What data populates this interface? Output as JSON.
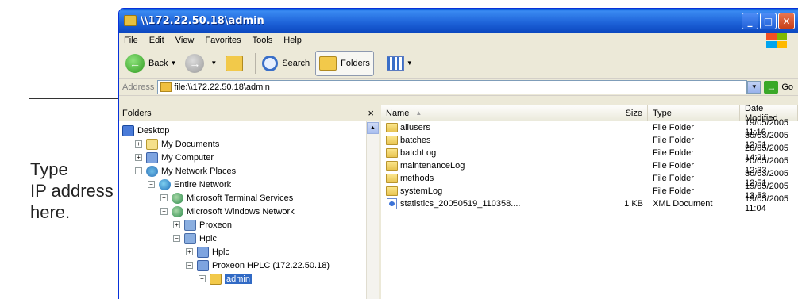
{
  "annotation": {
    "lines": [
      "Type",
      "IP address",
      "here."
    ]
  },
  "window": {
    "title": "\\\\172.22.50.18\\admin",
    "controls": [
      "_",
      "□",
      "✕"
    ]
  },
  "menu": [
    "File",
    "Edit",
    "View",
    "Favorites",
    "Tools",
    "Help"
  ],
  "toolbar": {
    "back_label": "Back",
    "search_label": "Search",
    "folders_label": "Folders"
  },
  "address": {
    "label": "Address",
    "value": "file:\\\\172.22.50.18\\admin",
    "go_label": "Go"
  },
  "folders_pane": {
    "header": "Folders",
    "close": "×",
    "tree": [
      {
        "label": "Desktop",
        "depth": 0,
        "icon": "desktop",
        "exp": ""
      },
      {
        "label": "My Documents",
        "depth": 1,
        "icon": "docs",
        "exp": "+"
      },
      {
        "label": "My Computer",
        "depth": 1,
        "icon": "comp",
        "exp": "+"
      },
      {
        "label": "My Network Places",
        "depth": 1,
        "icon": "net",
        "exp": "−"
      },
      {
        "label": "Entire Network",
        "depth": 2,
        "icon": "globe",
        "exp": "−"
      },
      {
        "label": "Microsoft Terminal Services",
        "depth": 3,
        "icon": "ms",
        "exp": "+"
      },
      {
        "label": "Microsoft Windows Network",
        "depth": 3,
        "icon": "ms",
        "exp": "−"
      },
      {
        "label": "Proxeon",
        "depth": 4,
        "icon": "group",
        "exp": "+"
      },
      {
        "label": "Hplc",
        "depth": 4,
        "icon": "group",
        "exp": "−"
      },
      {
        "label": "Hplc",
        "depth": 5,
        "icon": "comp",
        "exp": "+"
      },
      {
        "label": "Proxeon HPLC (172.22.50.18)",
        "depth": 5,
        "icon": "comp",
        "exp": "−"
      },
      {
        "label": "admin",
        "depth": 6,
        "icon": "share",
        "exp": "+"
      }
    ]
  },
  "file_list": {
    "columns": [
      "Name",
      "Size",
      "Type",
      "Date Modified"
    ],
    "rows": [
      {
        "name": "allusers",
        "size": "",
        "type": "File Folder",
        "date": "19/05/2005 11:16",
        "icon": "folder"
      },
      {
        "name": "batches",
        "size": "",
        "type": "File Folder",
        "date": "30/03/2005 12:51",
        "icon": "folder"
      },
      {
        "name": "batchLog",
        "size": "",
        "type": "File Folder",
        "date": "20/05/2005 14:21",
        "icon": "folder"
      },
      {
        "name": "maintenanceLog",
        "size": "",
        "type": "File Folder",
        "date": "20/05/2005 12:33",
        "icon": "folder"
      },
      {
        "name": "methods",
        "size": "",
        "type": "File Folder",
        "date": "30/03/2005 12:51",
        "icon": "folder"
      },
      {
        "name": "systemLog",
        "size": "",
        "type": "File Folder",
        "date": "19/05/2005 13:53",
        "icon": "folder"
      },
      {
        "name": "statistics_20050519_110358....",
        "size": "1 KB",
        "type": "XML Document",
        "date": "19/05/2005 11:04",
        "icon": "xml"
      }
    ]
  }
}
